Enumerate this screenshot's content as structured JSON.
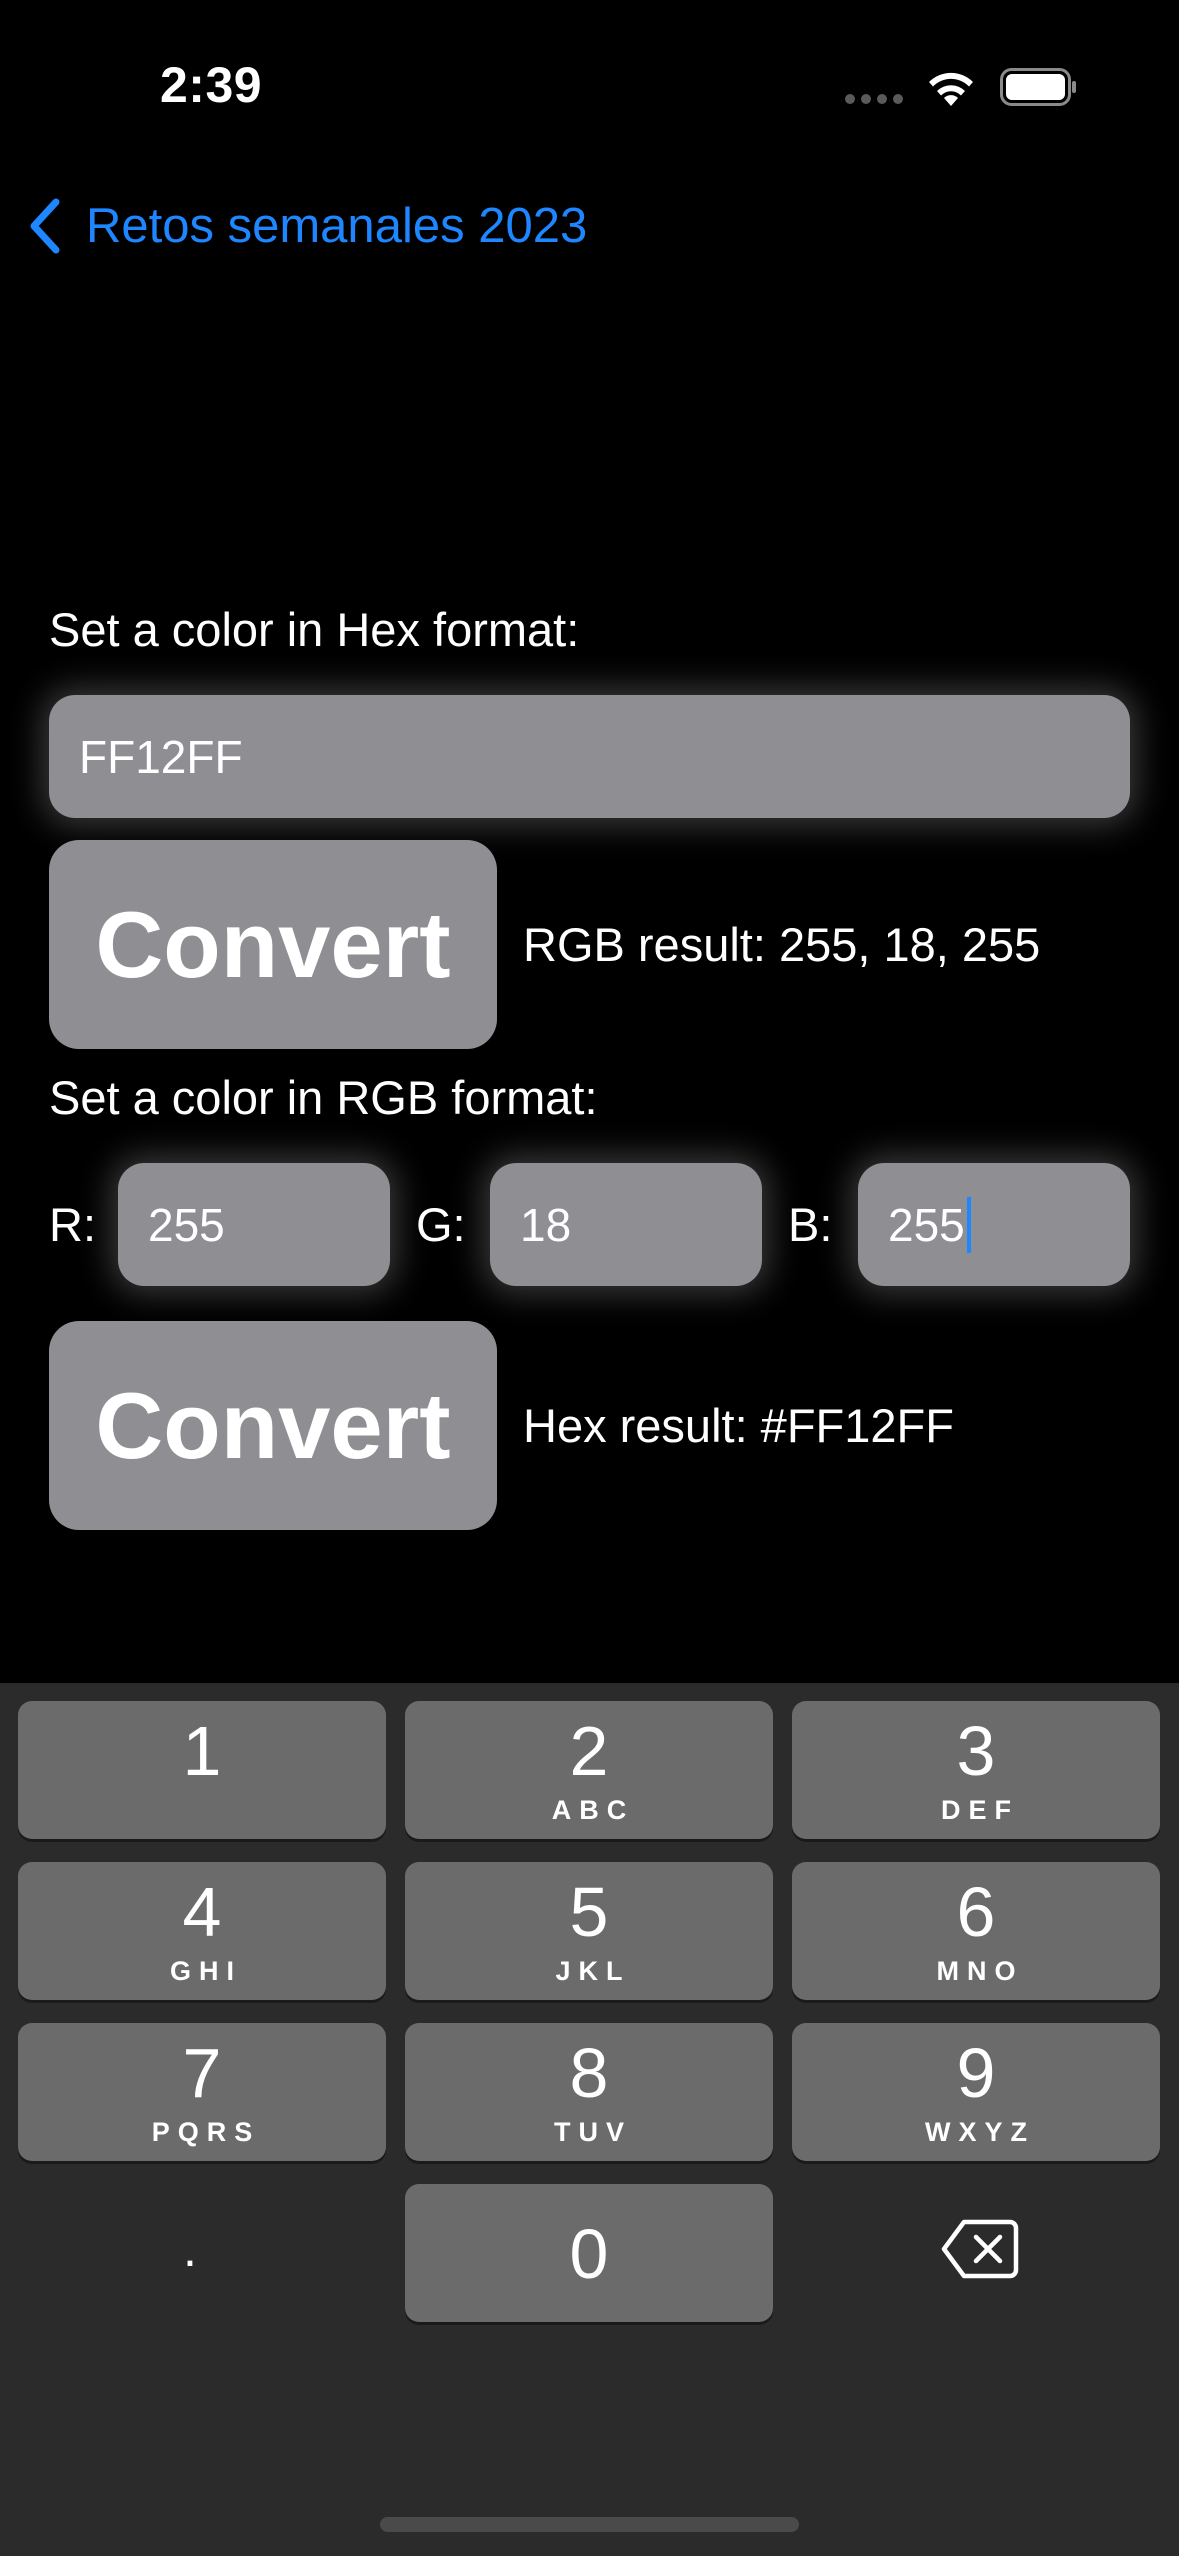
{
  "status": {
    "time": "2:39"
  },
  "nav": {
    "back_label": "Retos semanales 2023"
  },
  "hex_section": {
    "label": "Set a color in Hex format:",
    "input_value": "FF12FF",
    "button_label": "Convert",
    "result_text": "RGB result: 255, 18, 255"
  },
  "rgb_section": {
    "label": "Set a color in RGB format:",
    "r_label": "R:",
    "r_value": "255",
    "g_label": "G:",
    "g_value": "18",
    "b_label": "B:",
    "b_value": "255",
    "button_label": "Convert",
    "result_text": "Hex result: #FF12FF"
  },
  "keypad": {
    "keys": [
      {
        "num": "1",
        "letters": ""
      },
      {
        "num": "2",
        "letters": "ABC"
      },
      {
        "num": "3",
        "letters": "DEF"
      },
      {
        "num": "4",
        "letters": "GHI"
      },
      {
        "num": "5",
        "letters": "JKL"
      },
      {
        "num": "6",
        "letters": "MNO"
      },
      {
        "num": "7",
        "letters": "PQRS"
      },
      {
        "num": "8",
        "letters": "TUV"
      },
      {
        "num": "9",
        "letters": "WXYZ"
      },
      {
        "num": "0",
        "letters": ""
      }
    ],
    "dot": "."
  },
  "colors": {
    "accent": "#1e86ff",
    "field_bg": "#8e8e93",
    "key_bg": "#6b6b6b",
    "keypad_bg": "#2b2b2b"
  },
  "icons": [
    "chevron-left-icon",
    "wifi-icon",
    "battery-icon",
    "backspace-icon"
  ]
}
